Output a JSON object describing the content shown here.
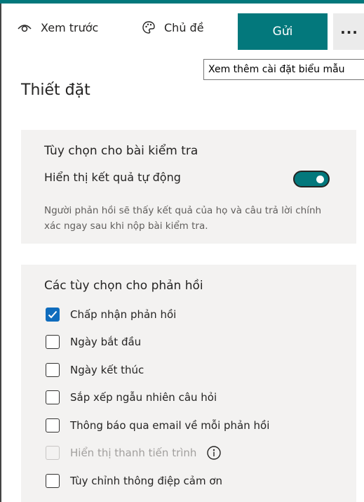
{
  "toolbar": {
    "preview_label": "Xem trước",
    "theme_label": "Chủ đề",
    "send_label": "Gửi",
    "more_label": "...",
    "tooltip": "Xem thêm cài đặt biểu mẫu",
    "accent_color": "#03787c"
  },
  "page": {
    "title": "Thiết đặt"
  },
  "quiz": {
    "title": "Tùy chọn cho bài kiểm tra",
    "auto_results_label": "Hiển thị kết quả tự động",
    "auto_results_on": true,
    "description": "Người phản hồi sẽ thấy kết quả của họ và câu trả lời chính xác ngay sau khi nộp bài kiểm tra."
  },
  "responses": {
    "title": "Các tùy chọn cho phản hồi",
    "options": [
      {
        "label": "Chấp nhận phản hồi",
        "checked": true,
        "disabled": false
      },
      {
        "label": "Ngày bắt đầu",
        "checked": false,
        "disabled": false
      },
      {
        "label": "Ngày kết thúc",
        "checked": false,
        "disabled": false
      },
      {
        "label": "Sắp xếp ngẫu nhiên câu hỏi",
        "checked": false,
        "disabled": false
      },
      {
        "label": "Thông báo qua email về mỗi phản hồi",
        "checked": false,
        "disabled": false
      },
      {
        "label": "Hiển thị thanh tiến trình",
        "checked": false,
        "disabled": true
      },
      {
        "label": "Tùy chỉnh thông điệp cảm ơn",
        "checked": false,
        "disabled": false
      }
    ]
  }
}
